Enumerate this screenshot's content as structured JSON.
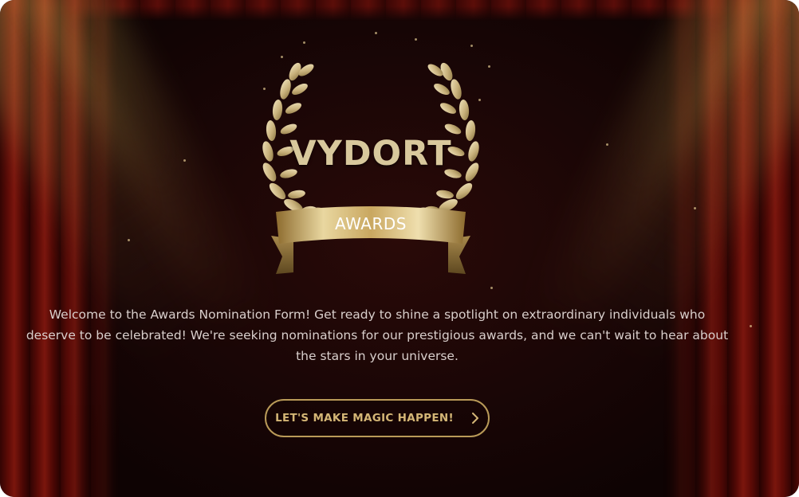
{
  "logo": {
    "title": "VYDORT",
    "ribbon": "AWARDS"
  },
  "intro": {
    "text": "Welcome to the Awards Nomination Form! Get ready to shine a spotlight on extraordinary individuals who deserve to be celebrated! We're seeking nominations for our prestigious awards, and we can't wait to hear about the stars in your universe."
  },
  "cta": {
    "label": "LET'S MAKE MAGIC HAPPEN!",
    "icon": "chevron-right-icon"
  },
  "colors": {
    "gold": "#d4b676",
    "border": "#b99a58",
    "background": "#1a0606",
    "curtain": "#8e1a10"
  }
}
